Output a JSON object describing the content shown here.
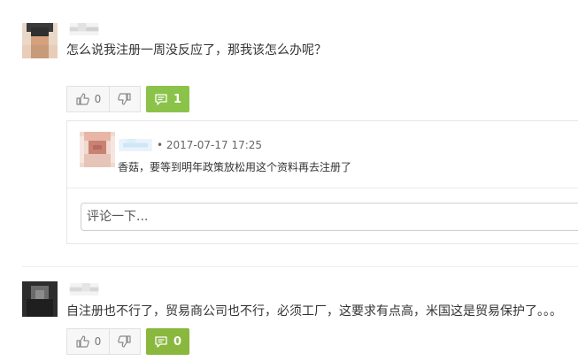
{
  "comments": [
    {
      "text": "怎么说我注册一周没反应了，那我该怎么办呢？",
      "likes": "0",
      "replies": "1"
    },
    {
      "text": "自注册也不行了，贸易商公司也不行，必须工厂，这要求有点高，米国这是贸易保护了。。。",
      "likes": "0",
      "replies": "0"
    }
  ],
  "reply": {
    "separator": "•",
    "date": "2017-07-17 17:25",
    "text": "香菇，要等到明年政策放松用这个资料再去注册了"
  },
  "input": {
    "placeholder": "评论一下..."
  },
  "icons": {
    "like": "thumbs-up-icon",
    "dislike": "thumbs-down-icon",
    "reply": "comment-icon"
  },
  "colors": {
    "accent": "#8bc34a"
  }
}
